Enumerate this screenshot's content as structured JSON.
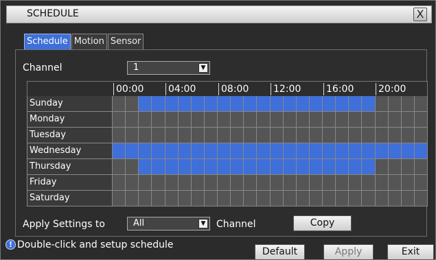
{
  "window": {
    "title": "SCHEDULE",
    "close_label": "X"
  },
  "tabs": [
    {
      "label": "Schedule",
      "active": true
    },
    {
      "label": "Motion",
      "active": false
    },
    {
      "label": "Sensor",
      "active": false
    }
  ],
  "channel": {
    "label": "Channel",
    "value": "1"
  },
  "hours": [
    "00:00",
    "04:00",
    "08:00",
    "12:00",
    "16:00",
    "20:00"
  ],
  "schedule": [
    {
      "day": "Sunday",
      "on": [
        [
          2,
          19
        ]
      ]
    },
    {
      "day": "Monday",
      "on": []
    },
    {
      "day": "Tuesday",
      "on": []
    },
    {
      "day": "Wednesday",
      "on": [
        [
          0,
          23
        ]
      ]
    },
    {
      "day": "Thursday",
      "on": [
        [
          2,
          19
        ]
      ]
    },
    {
      "day": "Friday",
      "on": []
    },
    {
      "day": "Saturday",
      "on": []
    }
  ],
  "apply_settings": {
    "label": "Apply Settings to",
    "value": "All",
    "suffix": "Channel",
    "copy_label": "Copy"
  },
  "footer": {
    "hint": "Double-click and setup schedule",
    "default_label": "Default",
    "apply_label": "Apply",
    "exit_label": "Exit"
  },
  "colors": {
    "active": "#3f6fd8",
    "inactive": "#555555"
  }
}
